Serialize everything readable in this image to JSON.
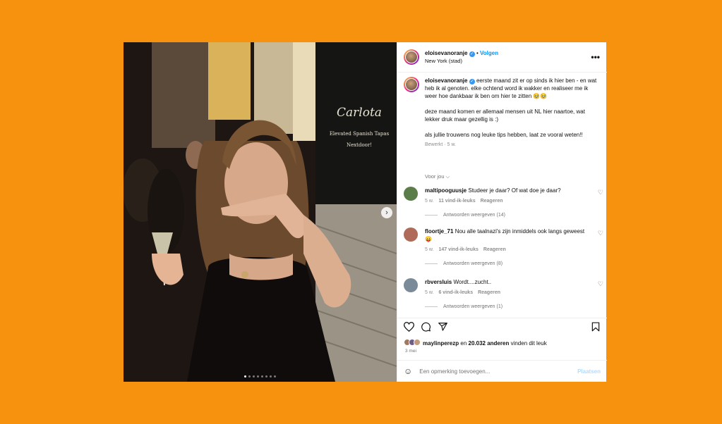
{
  "header": {
    "username": "eloisevanoranje",
    "separator": "•",
    "follow_label": "Volgen",
    "location": "New York (stad)",
    "more_label": "•••"
  },
  "photo": {
    "chalkboard_lines": [
      "Carlota",
      "Elevated Spanish Tapas",
      "Nextdoor!"
    ],
    "carousel_dot_count": 8,
    "active_dot": 1
  },
  "caption": {
    "username": "eloisevanoranje",
    "paragraph1": "eerste maand zit er op sinds ik hier ben - en wat heb ik al genoten. elke ochtend word ik wakker en realiseer me ik weer hoe dankbaar ik ben om hier te zitten 🥹🥹",
    "paragraph2": "deze maand komen er allemaal mensen uit NL hier naartoe, wat lekker druk maar gezellig is :)",
    "paragraph3": "als jullie trouwens nog leuke tips hebben, laat ze vooral weten!!",
    "edited": "Bewerkt · 5 w.",
    "see_translation": "Voor jou ⌵"
  },
  "comments": [
    {
      "username": "maltipooguusje",
      "text": "Studeer je daar? Of wat doe je daar?",
      "age": "5 w.",
      "likes": "11 vind-ik-leuks",
      "reply": "Reageren",
      "view_replies": "Antwoorden weergeven (14)",
      "avatar_color": "#5a7d4a"
    },
    {
      "username": "floortje_71",
      "text": "Nou alle taalnazi's zijn inmiddels ook langs geweest 😛",
      "age": "5 w.",
      "likes": "147 vind-ik-leuks",
      "reply": "Reageren",
      "view_replies": "Antwoorden weergeven (8)",
      "avatar_color": "#b06a5a"
    },
    {
      "username": "rbversluis",
      "text": "Wordt....zucht..",
      "age": "5 w.",
      "likes": "6 vind-ik-leuks",
      "reply": "Reageren",
      "view_replies": "Antwoorden weergeven (1)",
      "avatar_color": "#7a8a99"
    }
  ],
  "likes": {
    "user": "maylinperezp",
    "connector": "en",
    "count": "20.032 anderen",
    "suffix": "vinden dit leuk"
  },
  "date": "3 mei",
  "add_comment": {
    "placeholder": "Een opmerking toevoegen...",
    "post_label": "Plaatsen"
  },
  "colors": {
    "background": "#F7920E",
    "link": "#0095f6",
    "post_disabled": "#b3dbff"
  }
}
